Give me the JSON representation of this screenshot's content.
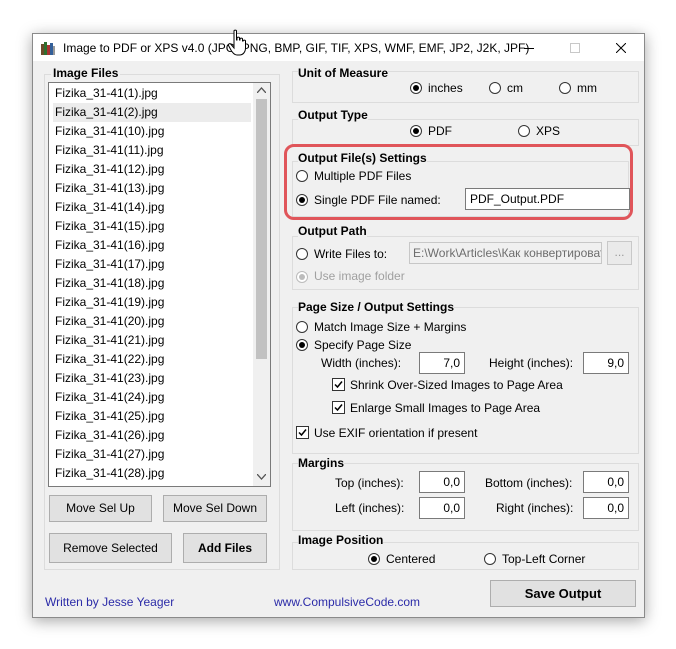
{
  "window": {
    "title": "Image to PDF or XPS  v4.0   (JPG, PNG, BMP, GIF, TIF, XPS, WMF, EMF, JP2, J2K, JPF)"
  },
  "image_files": {
    "label": "Image Files",
    "items": [
      "Fizika_31-41(1).jpg",
      "Fizika_31-41(2).jpg",
      "Fizika_31-41(10).jpg",
      "Fizika_31-41(11).jpg",
      "Fizika_31-41(12).jpg",
      "Fizika_31-41(13).jpg",
      "Fizika_31-41(14).jpg",
      "Fizika_31-41(15).jpg",
      "Fizika_31-41(16).jpg",
      "Fizika_31-41(17).jpg",
      "Fizika_31-41(18).jpg",
      "Fizika_31-41(19).jpg",
      "Fizika_31-41(20).jpg",
      "Fizika_31-41(21).jpg",
      "Fizika_31-41(22).jpg",
      "Fizika_31-41(23).jpg",
      "Fizika_31-41(24).jpg",
      "Fizika_31-41(25).jpg",
      "Fizika_31-41(26).jpg",
      "Fizika_31-41(27).jpg",
      "Fizika_31-41(28).jpg"
    ],
    "selected_item": "Fizika_31-41(2).jpg"
  },
  "buttons": {
    "move_up": "Move Sel Up",
    "move_down": "Move Sel Down",
    "remove_selected": "Remove Selected",
    "add_files": "Add Files",
    "save_output": "Save Output",
    "browse": "..."
  },
  "unit_of_measure": {
    "label": "Unit of Measure",
    "options": [
      "inches",
      "cm",
      "mm"
    ],
    "selected": "inches"
  },
  "output_type": {
    "label": "Output Type",
    "options": [
      "PDF",
      "XPS"
    ],
    "selected": "PDF"
  },
  "output_file_settings": {
    "label": "Output File(s) Settings",
    "multiple": "Multiple PDF Files",
    "single": "Single PDF File named:",
    "selected": "single",
    "file_name": "PDF_Output.PDF"
  },
  "output_path": {
    "label": "Output Path",
    "write_files_to": "Write Files to:",
    "path": "E:\\Work\\Articles\\Как конвертировать",
    "use_image_folder": "Use image folder",
    "use_image_folder_selected": true
  },
  "page_size": {
    "label": "Page Size / Output Settings",
    "match": "Match Image Size + Margins",
    "specify": "Specify Page Size",
    "selected": "specify",
    "width_label": "Width (inches):",
    "width": "7,0",
    "height_label": "Height (inches):",
    "height": "9,0",
    "shrink": "Shrink Over-Sized Images to Page Area",
    "shrink_checked": true,
    "enlarge": "Enlarge Small Images to Page Area",
    "enlarge_checked": true,
    "exif": "Use EXIF orientation if present",
    "exif_checked": true
  },
  "margins": {
    "label": "Margins",
    "top_label": "Top (inches):",
    "top": "0,0",
    "bottom_label": "Bottom (inches):",
    "bottom": "0,0",
    "left_label": "Left (inches):",
    "left": "0,0",
    "right_label": "Right (inches):",
    "right": "0,0"
  },
  "image_position": {
    "label": "Image Position",
    "options": [
      "Centered",
      "Top-Left Corner"
    ],
    "selected": "Centered"
  },
  "footer": {
    "author": "Written by Jesse Yeager",
    "website": "www.CompulsiveCode.com"
  },
  "colors": {
    "highlight": "#e0555a",
    "link": "#2b2ba8",
    "window_bg": "#f0f0f0"
  }
}
